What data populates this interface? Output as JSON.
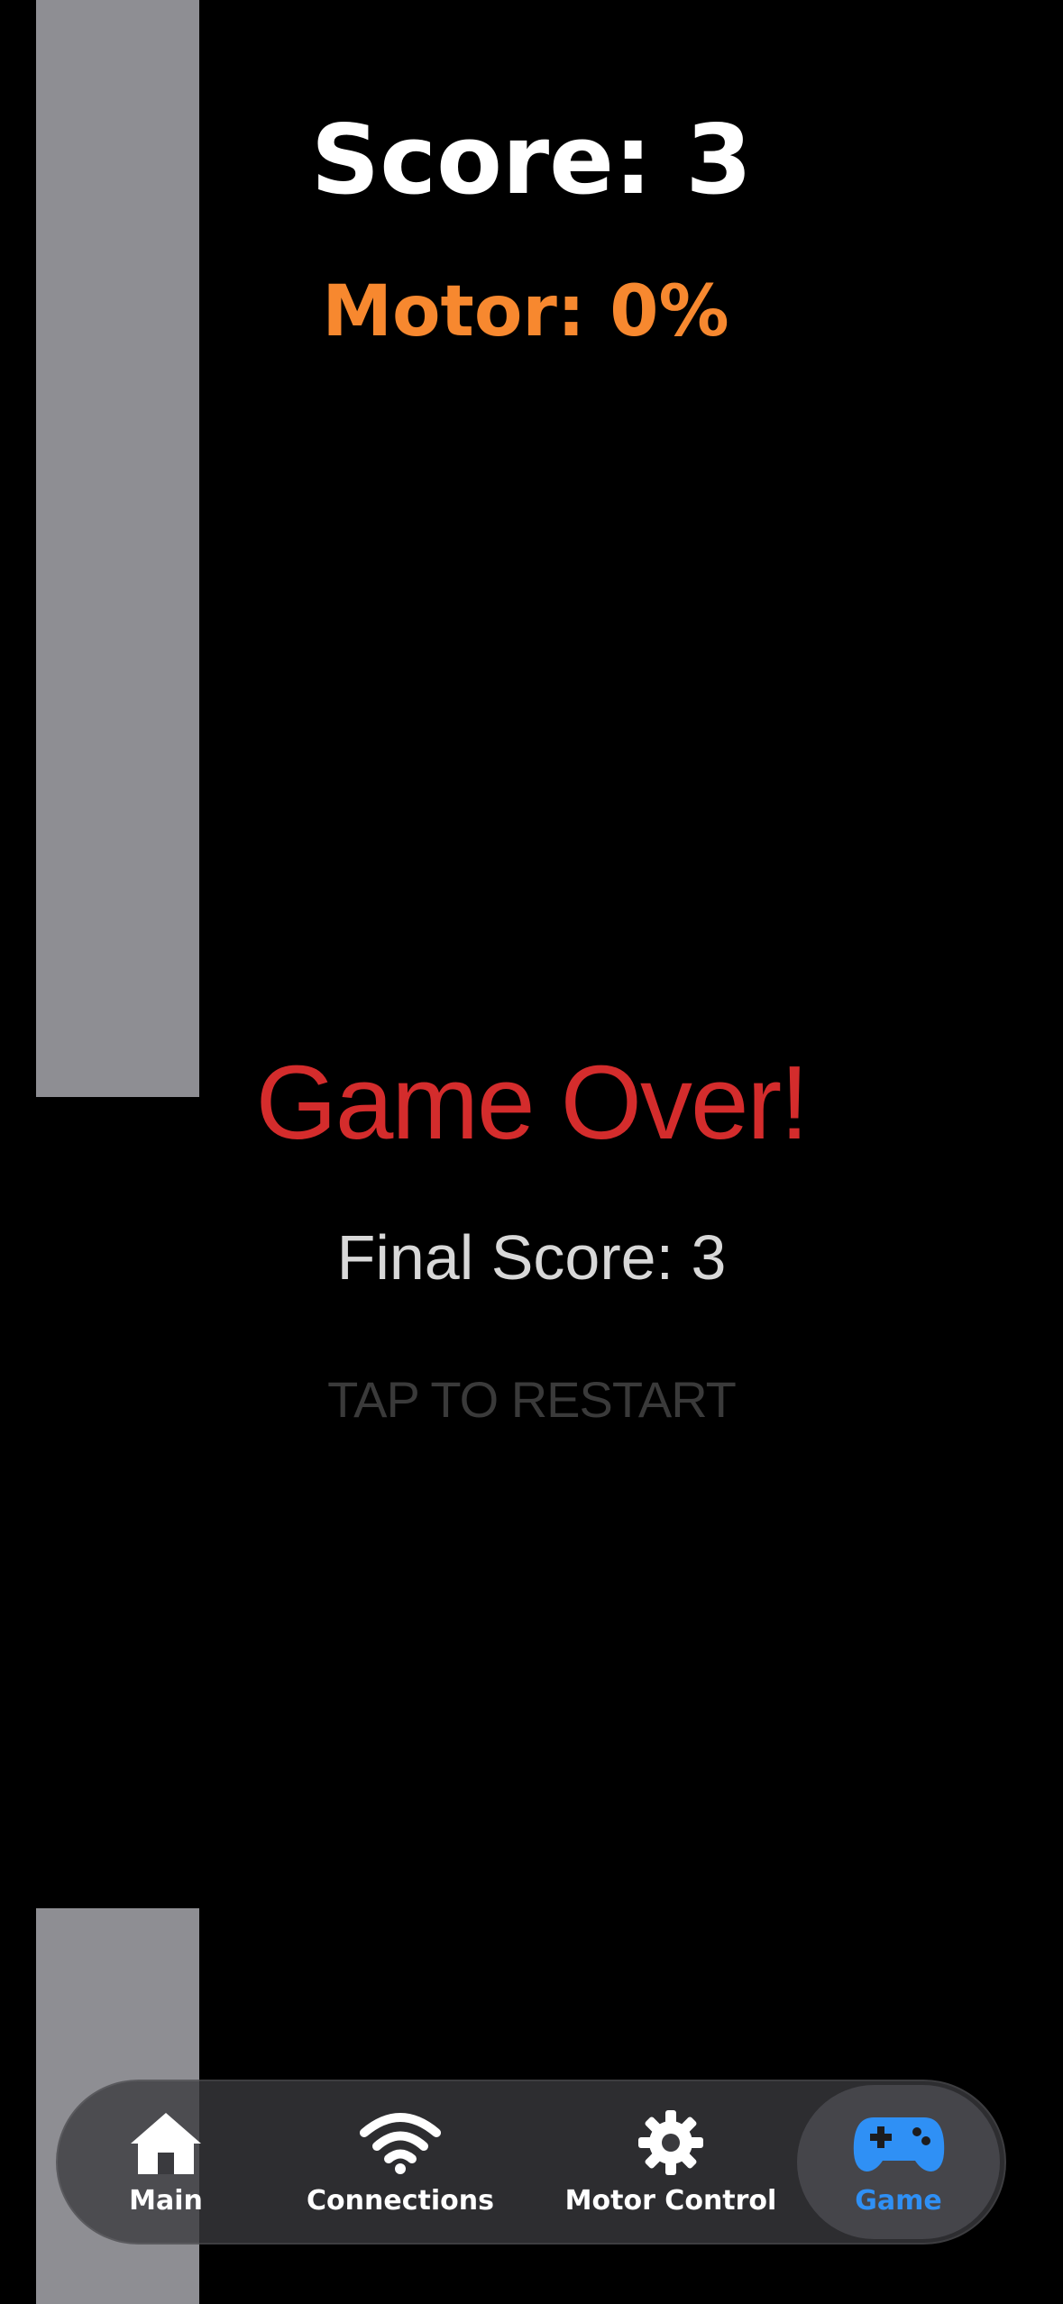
{
  "hud": {
    "score": "Score: 3",
    "motor": "Motor: 0%"
  },
  "game_over": {
    "title": "Game Over!",
    "final_score": "Final Score: 3",
    "restart_prompt": "TAP TO RESTART"
  },
  "tab_bar": {
    "tabs": [
      {
        "label": "Main",
        "icon": "house-icon",
        "selected": false
      },
      {
        "label": "Connections",
        "icon": "wifi-icon",
        "selected": false
      },
      {
        "label": "Motor Control",
        "icon": "gear-icon",
        "selected": false
      },
      {
        "label": "Game",
        "icon": "gamecontroller-icon",
        "selected": true
      }
    ]
  },
  "colors": {
    "background": "#000000",
    "pipe": "#8e8e93",
    "score": "#ffffff",
    "motor": "#f7882f",
    "game_over": "#d42c2c",
    "accent": "#2f90f5"
  }
}
